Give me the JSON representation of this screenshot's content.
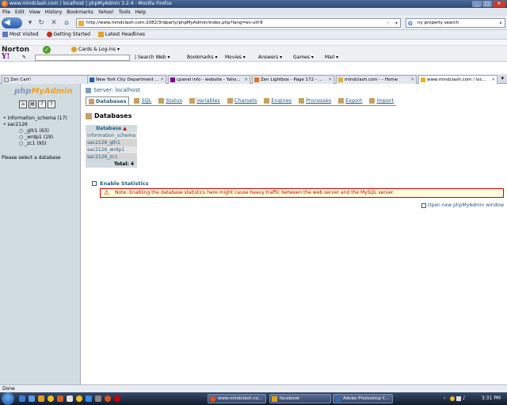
{
  "window": {
    "title": "www.mindclash.com / localhost | phpMyAdmin 3.2.4 - Mozilla Firefox"
  },
  "menu": [
    "File",
    "Edit",
    "View",
    "History",
    "Bookmarks",
    "Yahoo!",
    "Tools",
    "Help"
  ],
  "nav": {
    "url": "http://www.mindclash.com:2082/3rdparty/phpMyAdmin/index.php?lang=en-utf-8",
    "search_value": "ny property search"
  },
  "bookmarks": [
    "Most Visited",
    "Getting Started",
    "Latest Headlines"
  ],
  "norton": {
    "logo": "Norton",
    "cards": "Cards & Log-ins"
  },
  "yahoo": {
    "logo": "Y!",
    "items": [
      "Search Web",
      "Bookmarks",
      "Movies",
      "Answers",
      "Games",
      "Mail"
    ]
  },
  "tabs": [
    {
      "label": "Zen Cart!"
    },
    {
      "label": "New York City Department ..."
    },
    {
      "label": "cpanel info - website - Yaho..."
    },
    {
      "label": "Zen Lightbox - Page 172 - ..."
    },
    {
      "label": "mindclash.com - - Home"
    },
    {
      "label": "www.mindclash.com / loc..."
    }
  ],
  "sidebar": {
    "logo_php": "php",
    "logo_my": "MyAdmin",
    "databases": [
      {
        "name": "information_schema (17)"
      },
      {
        "name": "sac2126",
        "children": [
          "_gllr1 (63)",
          "_wrdp1 (19)",
          "_zc1 (95)"
        ]
      }
    ],
    "select_prompt": "Please select a database"
  },
  "main": {
    "server": "Server: localhost",
    "tabs": [
      "Databases",
      "SQL",
      "Status",
      "Variables",
      "Charsets",
      "Engines",
      "Processes",
      "Export",
      "Import"
    ],
    "heading": "Databases",
    "table_header": "Database",
    "sort_indicator": "▲",
    "rows": [
      "information_schema",
      "sac2126_gllr1",
      "sac2126_wrdp1",
      "sac2126_zc1"
    ],
    "total": "Total: 4",
    "enable_stats": "Enable Statistics",
    "notice": "Note: Enabling the database statistics here might cause heavy traffic between the web server and the MySQL server.",
    "new_window": "Open new phpMyAdmin window"
  },
  "status": "Done",
  "taskbar": {
    "tasks": [
      "www.mindclash.co...",
      "facebook",
      "Adobe Photoshop C..."
    ],
    "clock": "3:31 PM"
  }
}
